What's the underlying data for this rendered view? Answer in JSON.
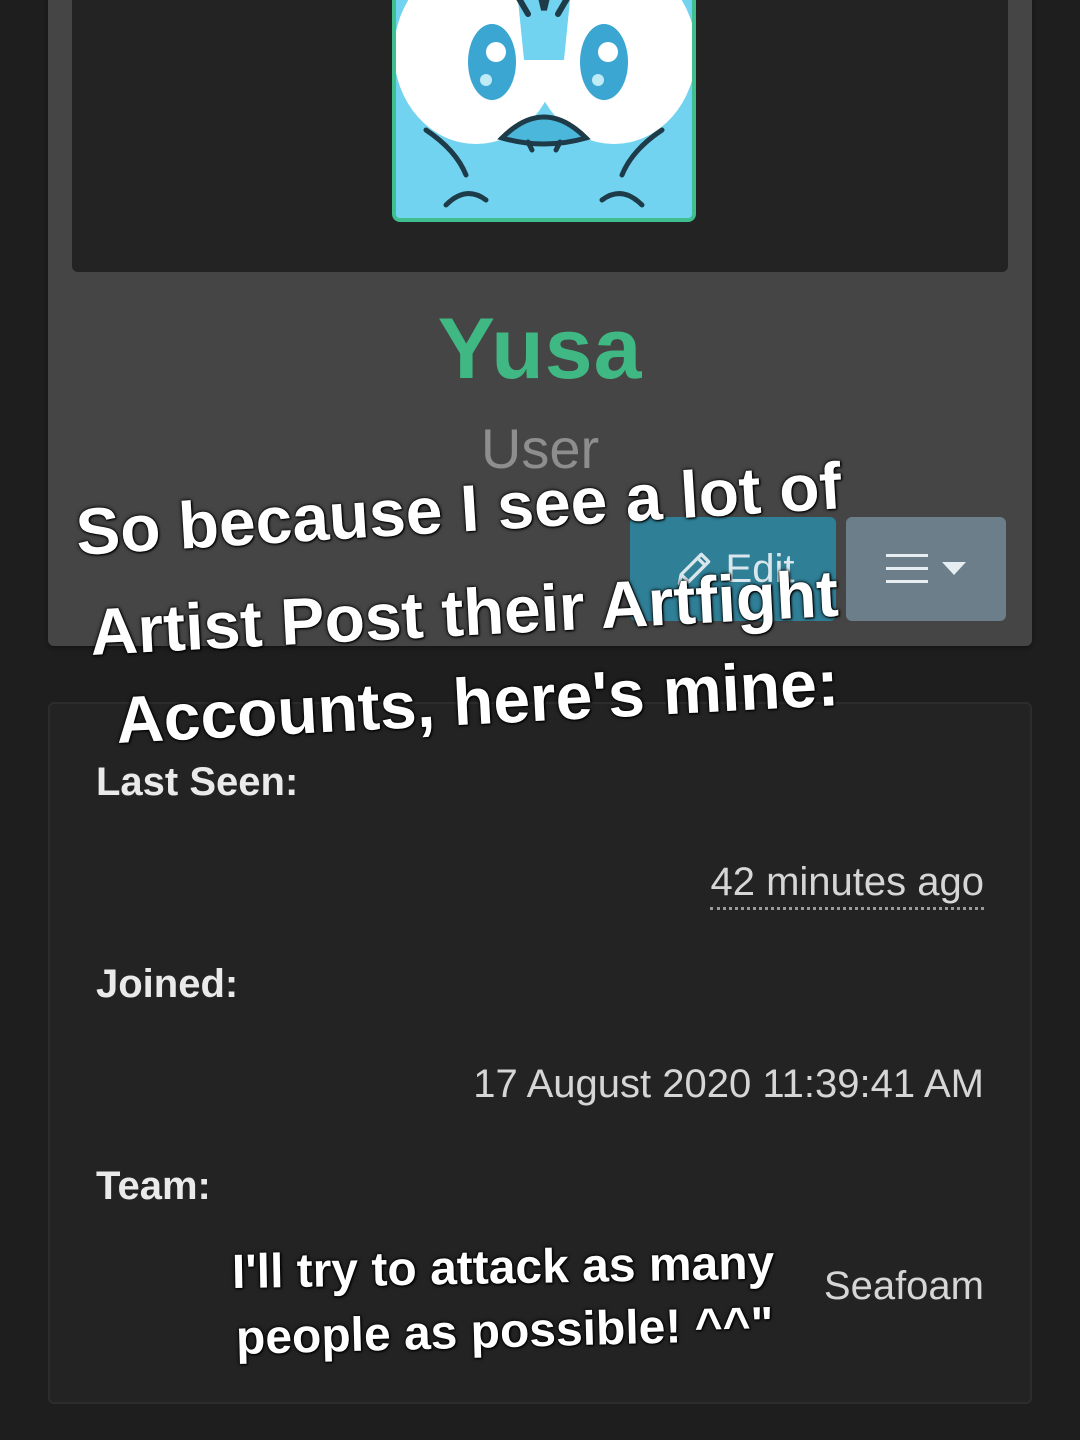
{
  "profile": {
    "username": "Yusa",
    "role": "User",
    "edit_label": "Edit",
    "colors": {
      "username": "#3fb883",
      "edit_button": "#2f7f97",
      "menu_button": "#6b7e8a"
    }
  },
  "stats": {
    "last_seen_label": "Last Seen:",
    "last_seen_value": "42 minutes ago",
    "joined_label": "Joined:",
    "joined_value": "17 August 2020 11:39:41 AM",
    "team_label": "Team:",
    "team_value": "Seafoam"
  },
  "overlay": {
    "caption_lines": [
      "So because I see a lot of",
      "Artist Post their Artfight",
      "Accounts, here's mine:"
    ],
    "bio_lines": [
      "I'll try to attack as many",
      "people as possible! ^^\""
    ]
  },
  "icons": {
    "edit": "pencil-icon",
    "menu": "hamburger-icon",
    "dropdown": "caret-down-icon"
  }
}
